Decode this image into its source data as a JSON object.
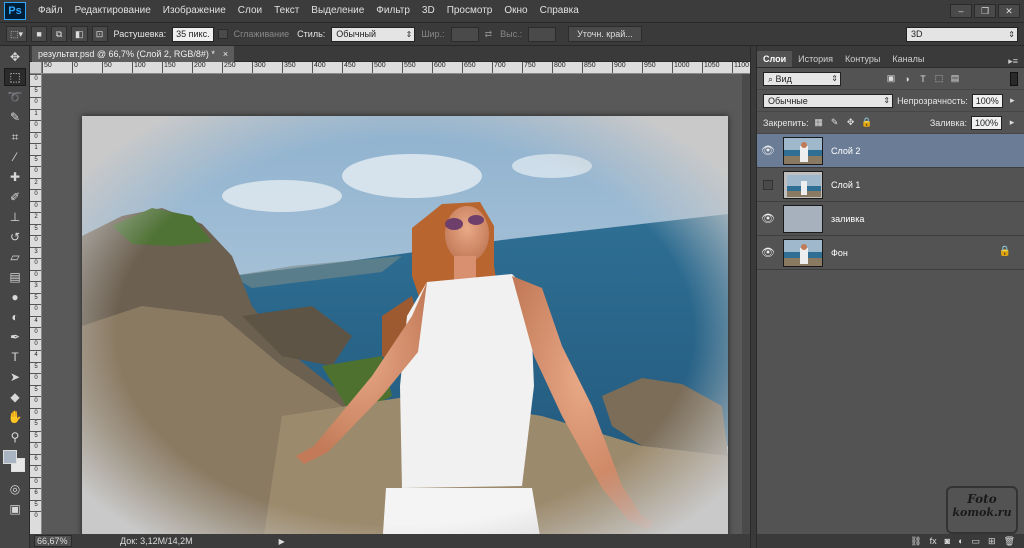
{
  "app": {
    "logo": "Ps"
  },
  "menu": [
    "Файл",
    "Редактирование",
    "Изображение",
    "Слои",
    "Текст",
    "Выделение",
    "Фильтр",
    "3D",
    "Просмотр",
    "Окно",
    "Справка"
  ],
  "window_controls": {
    "minimize": "‒",
    "restore": "❐",
    "close": "✕"
  },
  "options": {
    "feather_label": "Растушевка:",
    "feather_value": "35 пикс.",
    "antialias_label": "Сглаживание",
    "style_label": "Стиль:",
    "style_value": "Обычный",
    "width_label": "Шир.:",
    "height_label": "Выс.:",
    "refine_edge": "Уточн. край...",
    "workspace": "3D"
  },
  "document": {
    "tab_title": "результат.psd @ 66,7% (Слой 2, RGB/8#) *",
    "tab_close": "×",
    "ruler_top": [
      "50",
      "0",
      "50",
      "100",
      "150",
      "200",
      "250",
      "300",
      "350",
      "400",
      "450",
      "500",
      "550",
      "600",
      "650",
      "700",
      "750",
      "800",
      "850",
      "900",
      "950",
      "1000",
      "1050",
      "1100"
    ],
    "ruler_left": [
      "0",
      "5",
      "0",
      "1",
      "0",
      "0",
      "1",
      "5",
      "0",
      "2",
      "0",
      "0",
      "2",
      "5",
      "0",
      "3",
      "0",
      "0",
      "3",
      "5",
      "0",
      "4",
      "0",
      "0",
      "4",
      "5",
      "0",
      "5",
      "0",
      "0",
      "5",
      "5",
      "0",
      "6",
      "0",
      "0",
      "6",
      "5",
      "0"
    ]
  },
  "status": {
    "zoom": "66,67%",
    "doc_size": "Док: 3,12M/14,2M",
    "arrow": "▶"
  },
  "panel": {
    "tabs": [
      "Слои",
      "История",
      "Контуры",
      "Каналы"
    ],
    "active_tab": "Слои",
    "menu_glyph": "▸≡",
    "filter_kind": "Вид",
    "blend_mode": "Обычные",
    "opacity_label": "Непрозрачность:",
    "opacity_value": "100%",
    "lock_label": "Закрепить:",
    "fill_label": "Заливка:",
    "fill_value": "100%",
    "layers": [
      {
        "name": "Слой 2",
        "visible": true,
        "selected": true,
        "thumb": "photo"
      },
      {
        "name": "Слой 1",
        "visible": false,
        "selected": false,
        "thumb": "photo"
      },
      {
        "name": "заливка",
        "visible": true,
        "selected": false,
        "thumb": "fill"
      },
      {
        "name": "Фон",
        "visible": true,
        "selected": false,
        "thumb": "photo",
        "locked": true
      }
    ],
    "bottom_icons": [
      "link-icon",
      "fx-icon",
      "mask-icon",
      "adjustment-icon",
      "folder-icon",
      "new-layer-icon",
      "trash-icon"
    ]
  },
  "colors": {
    "foreground": "#a9b4c2",
    "background": "#e6e6e6",
    "selected_layer": "#6b7d96",
    "fill_layer": "#a7b0bd"
  },
  "watermark": {
    "line1": "Foto",
    "line2": "komok.ru"
  }
}
